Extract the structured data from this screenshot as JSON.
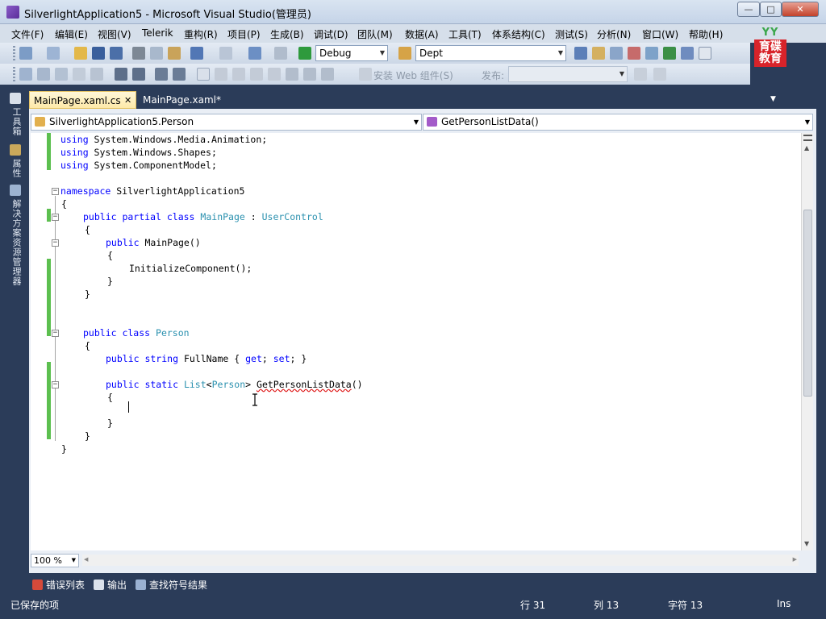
{
  "window": {
    "title": "SilverlightApplication5 - Microsoft Visual Studio(管理员)",
    "min_glyph": "—",
    "max_glyph": "□",
    "close_glyph": "✕"
  },
  "menu": [
    "文件(F)",
    "编辑(E)",
    "视图(V)",
    "Telerik",
    "重构(R)",
    "项目(P)",
    "生成(B)",
    "调试(D)",
    "团队(M)",
    "数据(A)",
    "工具(T)",
    "体系结构(C)",
    "测试(S)",
    "分析(N)",
    "窗口(W)",
    "帮助(H)"
  ],
  "toolbar": {
    "config_combo": "Debug",
    "search_combo": "Dept",
    "web_component_label": "安装 Web 组件(S)",
    "publish_label": "发布:",
    "publish_combo": ""
  },
  "logo": {
    "top": "YY",
    "text": "育碟教育"
  },
  "side_strip": {
    "toolbox": "工具箱",
    "properties": "属性",
    "solution_explorer": "解决方案资源管理器"
  },
  "doc_tabs": {
    "active": "MainPage.xaml.cs",
    "inactive": "MainPage.xaml*"
  },
  "nav": {
    "type_combo": "SilverlightApplication5.Person",
    "member_combo": "GetPersonListData()"
  },
  "code": {
    "l1_kw": "using",
    "l1_rest": " System.Windows.Media.Animation;",
    "l2_kw": "using",
    "l2_rest": " System.Windows.Shapes;",
    "l3_kw": "using",
    "l3_rest": " System.ComponentModel;",
    "l5_kw": "namespace",
    "l5_rest": " SilverlightApplication5",
    "open_brace": "{",
    "close_brace": "}",
    "l7_kw": "public partial class",
    "l7_type": "MainPage",
    "l7_sep": " : ",
    "l7_base": "UserControl",
    "l9_kw": "public",
    "l9_rest": " MainPage()",
    "l11_rest": "InitializeComponent();",
    "l16_kw": "public class",
    "l16_type": "Person",
    "l18_kw": "public string",
    "l18_mid": " FullName { ",
    "l18_get": "get",
    "l18_semi1": "; ",
    "l18_set": "set",
    "l18_end": "; }",
    "l20_kw": "public static",
    "l20_list": "List",
    "l20_lt": "<",
    "l20_person": "Person",
    "l20_gt": ">",
    "l20_name": "GetPersonListData",
    "l20_parens": "()"
  },
  "zoom": "100 %",
  "bottom_tabs": {
    "errors": "错误列表",
    "output": "输出",
    "find_symbol": "查找符号结果"
  },
  "status": {
    "message": "已保存的项",
    "line": "行 31",
    "column": "列 13",
    "char": "字符 13",
    "mode": "Ins"
  }
}
